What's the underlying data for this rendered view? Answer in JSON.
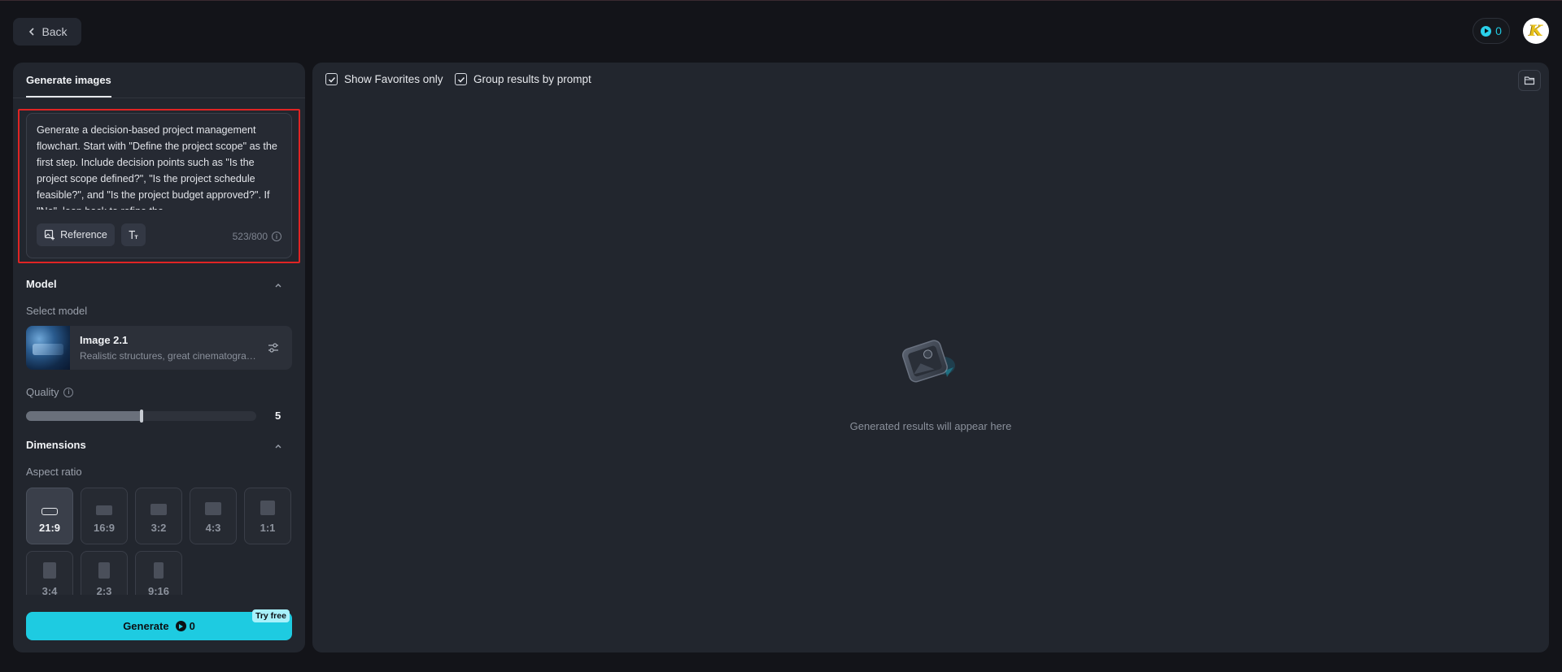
{
  "header": {
    "back_label": "Back",
    "credits": "0",
    "avatar_letter": "K"
  },
  "left_panel": {
    "tab_label": "Generate images",
    "prompt": {
      "text": "Generate a decision-based project management flowchart. Start with \"Define the project scope\" as the first step. Include decision points such as \"Is the project scope defined?\", \"Is the project schedule feasible?\", and \"Is the project budget approved?\". If \"No\", loop back to refine the",
      "reference_label": "Reference",
      "char_count": "523/800"
    },
    "model": {
      "section_title": "Model",
      "select_label": "Select model",
      "name": "Image 2.1",
      "description": "Realistic structures, great cinematography"
    },
    "quality": {
      "label": "Quality",
      "value": 5,
      "level_fraction": 0.5
    },
    "dimensions": {
      "section_title": "Dimensions",
      "aspect_label": "Aspect ratio",
      "ratios": [
        "21:9",
        "16:9",
        "3:2",
        "4:3",
        "1:1",
        "3:4",
        "2:3",
        "9:16"
      ],
      "selected": "21:9"
    },
    "generate": {
      "label": "Generate",
      "cost": "0",
      "badge": "Try free"
    }
  },
  "right_panel": {
    "show_favorites_label": "Show Favorites only",
    "group_by_prompt_label": "Group results by prompt",
    "show_favorites_checked": true,
    "group_by_prompt_checked": true,
    "empty_message": "Generated results will appear here"
  },
  "colors": {
    "accent": "#1ecbe1",
    "panel": "#22262e",
    "background": "#131419",
    "highlight": "#e02424"
  }
}
